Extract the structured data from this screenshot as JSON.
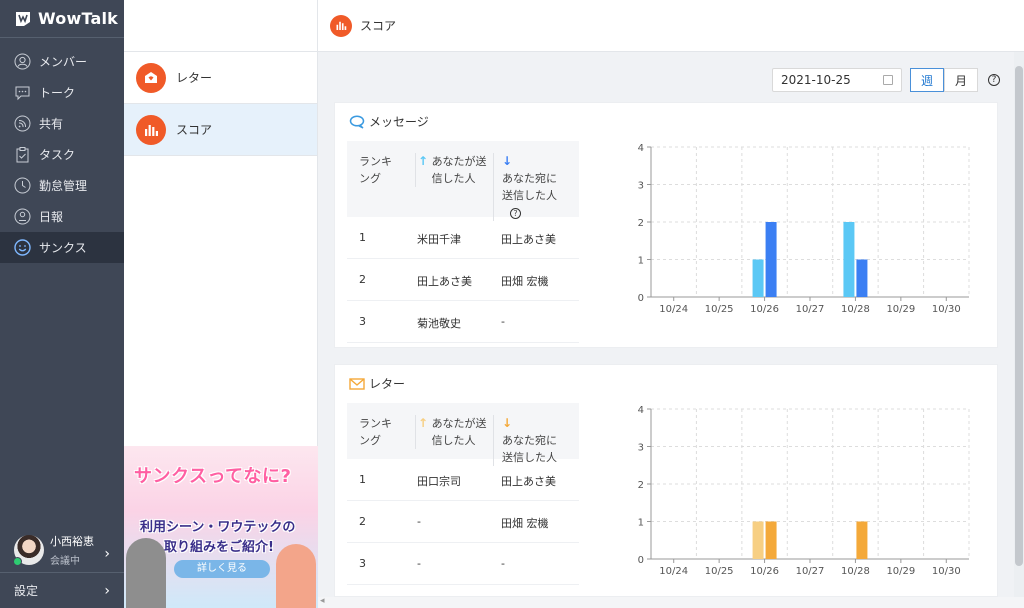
{
  "app": {
    "name": "WowTalk"
  },
  "sidebar": {
    "items": [
      {
        "label": "メンバー",
        "icon": "person-icon"
      },
      {
        "label": "トーク",
        "icon": "chat-icon"
      },
      {
        "label": "共有",
        "icon": "feed-icon"
      },
      {
        "label": "タスク",
        "icon": "clipboard-icon"
      },
      {
        "label": "勤怠管理",
        "icon": "clock-icon"
      },
      {
        "label": "日報",
        "icon": "report-icon"
      },
      {
        "label": "サンクス",
        "icon": "smile-icon",
        "active": true
      }
    ],
    "user": {
      "name": "小西裕恵",
      "status": "会議中"
    },
    "settings_label": "設定"
  },
  "middle": {
    "items": [
      {
        "label": "レター"
      },
      {
        "label": "スコア",
        "active": true
      }
    ],
    "banner": {
      "title": "サンクスってなに?",
      "line1": "利用シーン・ワウテックの",
      "line2": "取り組みをご紹介!",
      "button": "詳しく見る"
    }
  },
  "header": {
    "title": "スコア"
  },
  "toolbar": {
    "date": "2021-10-25",
    "week_label": "週",
    "month_label": "月",
    "help": "?"
  },
  "colors": {
    "accent_orange": "#f05a28",
    "blue_light": "#5bc8f5",
    "blue": "#3b7ff3",
    "orange_light": "#f7cf83",
    "orange": "#f4a93a"
  },
  "messages": {
    "title": "メッセージ",
    "headers": {
      "rank": "ランキング",
      "sent": "あなたが送信した人",
      "received": "あなた宛に送信した人"
    },
    "rows": [
      {
        "rank": "1",
        "sent": "米田千津",
        "received": "田上あさ美"
      },
      {
        "rank": "2",
        "sent": "田上あさ美",
        "received": "田畑 宏機"
      },
      {
        "rank": "3",
        "sent": "菊池敬史",
        "received": "-"
      }
    ]
  },
  "letters": {
    "title": "レター",
    "headers": {
      "rank": "ランキング",
      "sent": "あなたが送信した人",
      "received": "あなた宛に送信した人"
    },
    "rows": [
      {
        "rank": "1",
        "sent": "田口宗司",
        "received": "田上あさ美"
      },
      {
        "rank": "2",
        "sent": "-",
        "received": "田畑 宏機"
      },
      {
        "rank": "3",
        "sent": "-",
        "received": "-"
      }
    ]
  },
  "chart_data": [
    {
      "type": "bar",
      "categories": [
        "10/24",
        "10/25",
        "10/26",
        "10/27",
        "10/28",
        "10/29",
        "10/30"
      ],
      "ylim": [
        0,
        4
      ],
      "yticks": [
        "0",
        "1",
        "2",
        "3",
        "4"
      ],
      "grid": true,
      "series": [
        {
          "values": [
            0,
            0,
            1,
            0,
            2,
            0,
            0
          ],
          "color": "#5bc8f5"
        },
        {
          "values": [
            0,
            0,
            2,
            0,
            1,
            0,
            0
          ],
          "color": "#3b7ff3"
        }
      ]
    },
    {
      "type": "bar",
      "categories": [
        "10/24",
        "10/25",
        "10/26",
        "10/27",
        "10/28",
        "10/29",
        "10/30"
      ],
      "ylim": [
        0,
        4
      ],
      "yticks": [
        "0",
        "1",
        "2",
        "3",
        "4"
      ],
      "grid": true,
      "series": [
        {
          "values": [
            0,
            0,
            1,
            0,
            0,
            0,
            0
          ],
          "color": "#f7cf83"
        },
        {
          "values": [
            0,
            0,
            1,
            0,
            1,
            0,
            0
          ],
          "color": "#f4a93a"
        }
      ]
    }
  ]
}
